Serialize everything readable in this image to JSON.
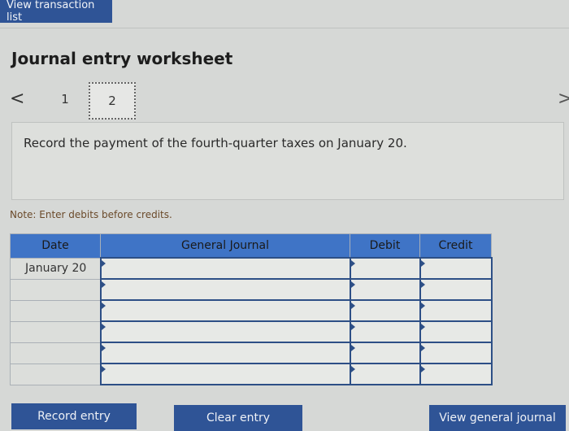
{
  "header": {
    "view_transactions_label": "View transaction list"
  },
  "worksheet": {
    "title": "Journal entry worksheet",
    "pages": [
      "1",
      "2"
    ],
    "current_page": "2",
    "prev_icon": "chevron-left-icon",
    "next_icon": "chevron-right-icon",
    "prev_glyph": "<",
    "next_glyph": ">",
    "prompt": "Record the payment of the fourth-quarter taxes on January 20.",
    "note": "Note: Enter debits before credits."
  },
  "journal_table": {
    "headers": [
      "Date",
      "General Journal",
      "Debit",
      "Credit"
    ],
    "rows": [
      {
        "date": "January 20"
      },
      {
        "date": ""
      },
      {
        "date": ""
      },
      {
        "date": ""
      },
      {
        "date": ""
      },
      {
        "date": ""
      }
    ]
  },
  "footer": {
    "record_label": "Record entry",
    "clear_label": "Clear entry",
    "view_journal_label": "View general journal"
  },
  "colors": {
    "button_bg": "#2f5496",
    "header_bg": "#3f74c6"
  }
}
